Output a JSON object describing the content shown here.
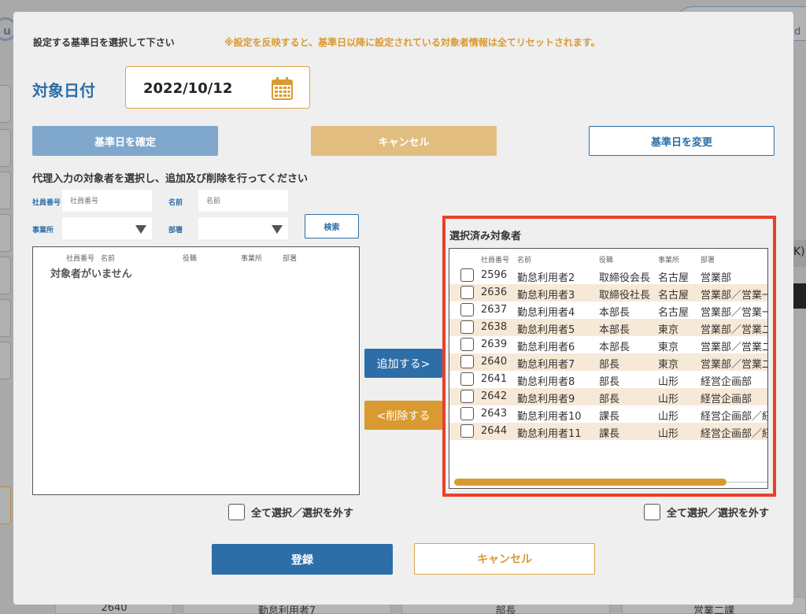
{
  "background": {
    "logo_text": "u",
    "top_button_label": "d",
    "right_chip_label": "K)",
    "bottom_row": [
      "2640",
      "勤怠利用者7",
      "部長",
      "営業二課"
    ]
  },
  "modal": {
    "instruction": "設定する基準日を選択して下さい",
    "warning": "※設定を反映すると、基準日以降に設定されている対象者情報は全てリセットされます。",
    "date_label": "対象日付",
    "date_value": "2022/10/12",
    "buttons": {
      "confirm_date": "基準日を確定",
      "cancel_top": "キャンセル",
      "change_date": "基準日を変更",
      "search": "検索",
      "add": "追加する>",
      "remove": "<削除する",
      "register": "登録",
      "cancel_bottom": "キャンセル"
    },
    "section_title": "代理入力の対象者を選択し、追加及び削除を行ってください",
    "filters": {
      "employee_no_label": "社員番号",
      "employee_no_placeholder": "社員番号",
      "name_label": "名前",
      "name_placeholder": "名前",
      "office_label": "事業所",
      "department_label": "部署"
    },
    "candidate_list": {
      "headers": [
        "社員番号",
        "名前",
        "役職",
        "事業所",
        "部署"
      ],
      "empty_message": "対象者がいません"
    },
    "selected_list": {
      "title": "選択済み対象者",
      "headers": [
        "社員番号",
        "名前",
        "役職",
        "事業所",
        "部署"
      ],
      "rows": [
        {
          "no": "2596",
          "name": "勤怠利用者2",
          "title": "取締役会長",
          "office": "名古屋",
          "dept": "営業部"
        },
        {
          "no": "2636",
          "name": "勤怠利用者3",
          "title": "取締役社長",
          "office": "名古屋",
          "dept": "営業部／営業一"
        },
        {
          "no": "2637",
          "name": "勤怠利用者4",
          "title": "本部長",
          "office": "名古屋",
          "dept": "営業部／営業一"
        },
        {
          "no": "2638",
          "name": "勤怠利用者5",
          "title": "本部長",
          "office": "東京",
          "dept": "営業部／営業二"
        },
        {
          "no": "2639",
          "name": "勤怠利用者6",
          "title": "本部長",
          "office": "東京",
          "dept": "営業部／営業二"
        },
        {
          "no": "2640",
          "name": "勤怠利用者7",
          "title": "部長",
          "office": "東京",
          "dept": "営業部／営業二"
        },
        {
          "no": "2641",
          "name": "勤怠利用者8",
          "title": "部長",
          "office": "山形",
          "dept": "経営企画部"
        },
        {
          "no": "2642",
          "name": "勤怠利用者9",
          "title": "部長",
          "office": "山形",
          "dept": "経営企画部"
        },
        {
          "no": "2643",
          "name": "勤怠利用者10",
          "title": "課長",
          "office": "山形",
          "dept": "経営企画部／経"
        },
        {
          "no": "2644",
          "name": "勤怠利用者11",
          "title": "課長",
          "office": "山形",
          "dept": "経営企画部／経"
        }
      ]
    },
    "select_all_label": "全て選択／選択を外す",
    "colors": {
      "primary": "#2d6ea8",
      "accent": "#d99a32",
      "highlight_border": "#e8402b",
      "row_alt": "#f7e9d7"
    }
  }
}
